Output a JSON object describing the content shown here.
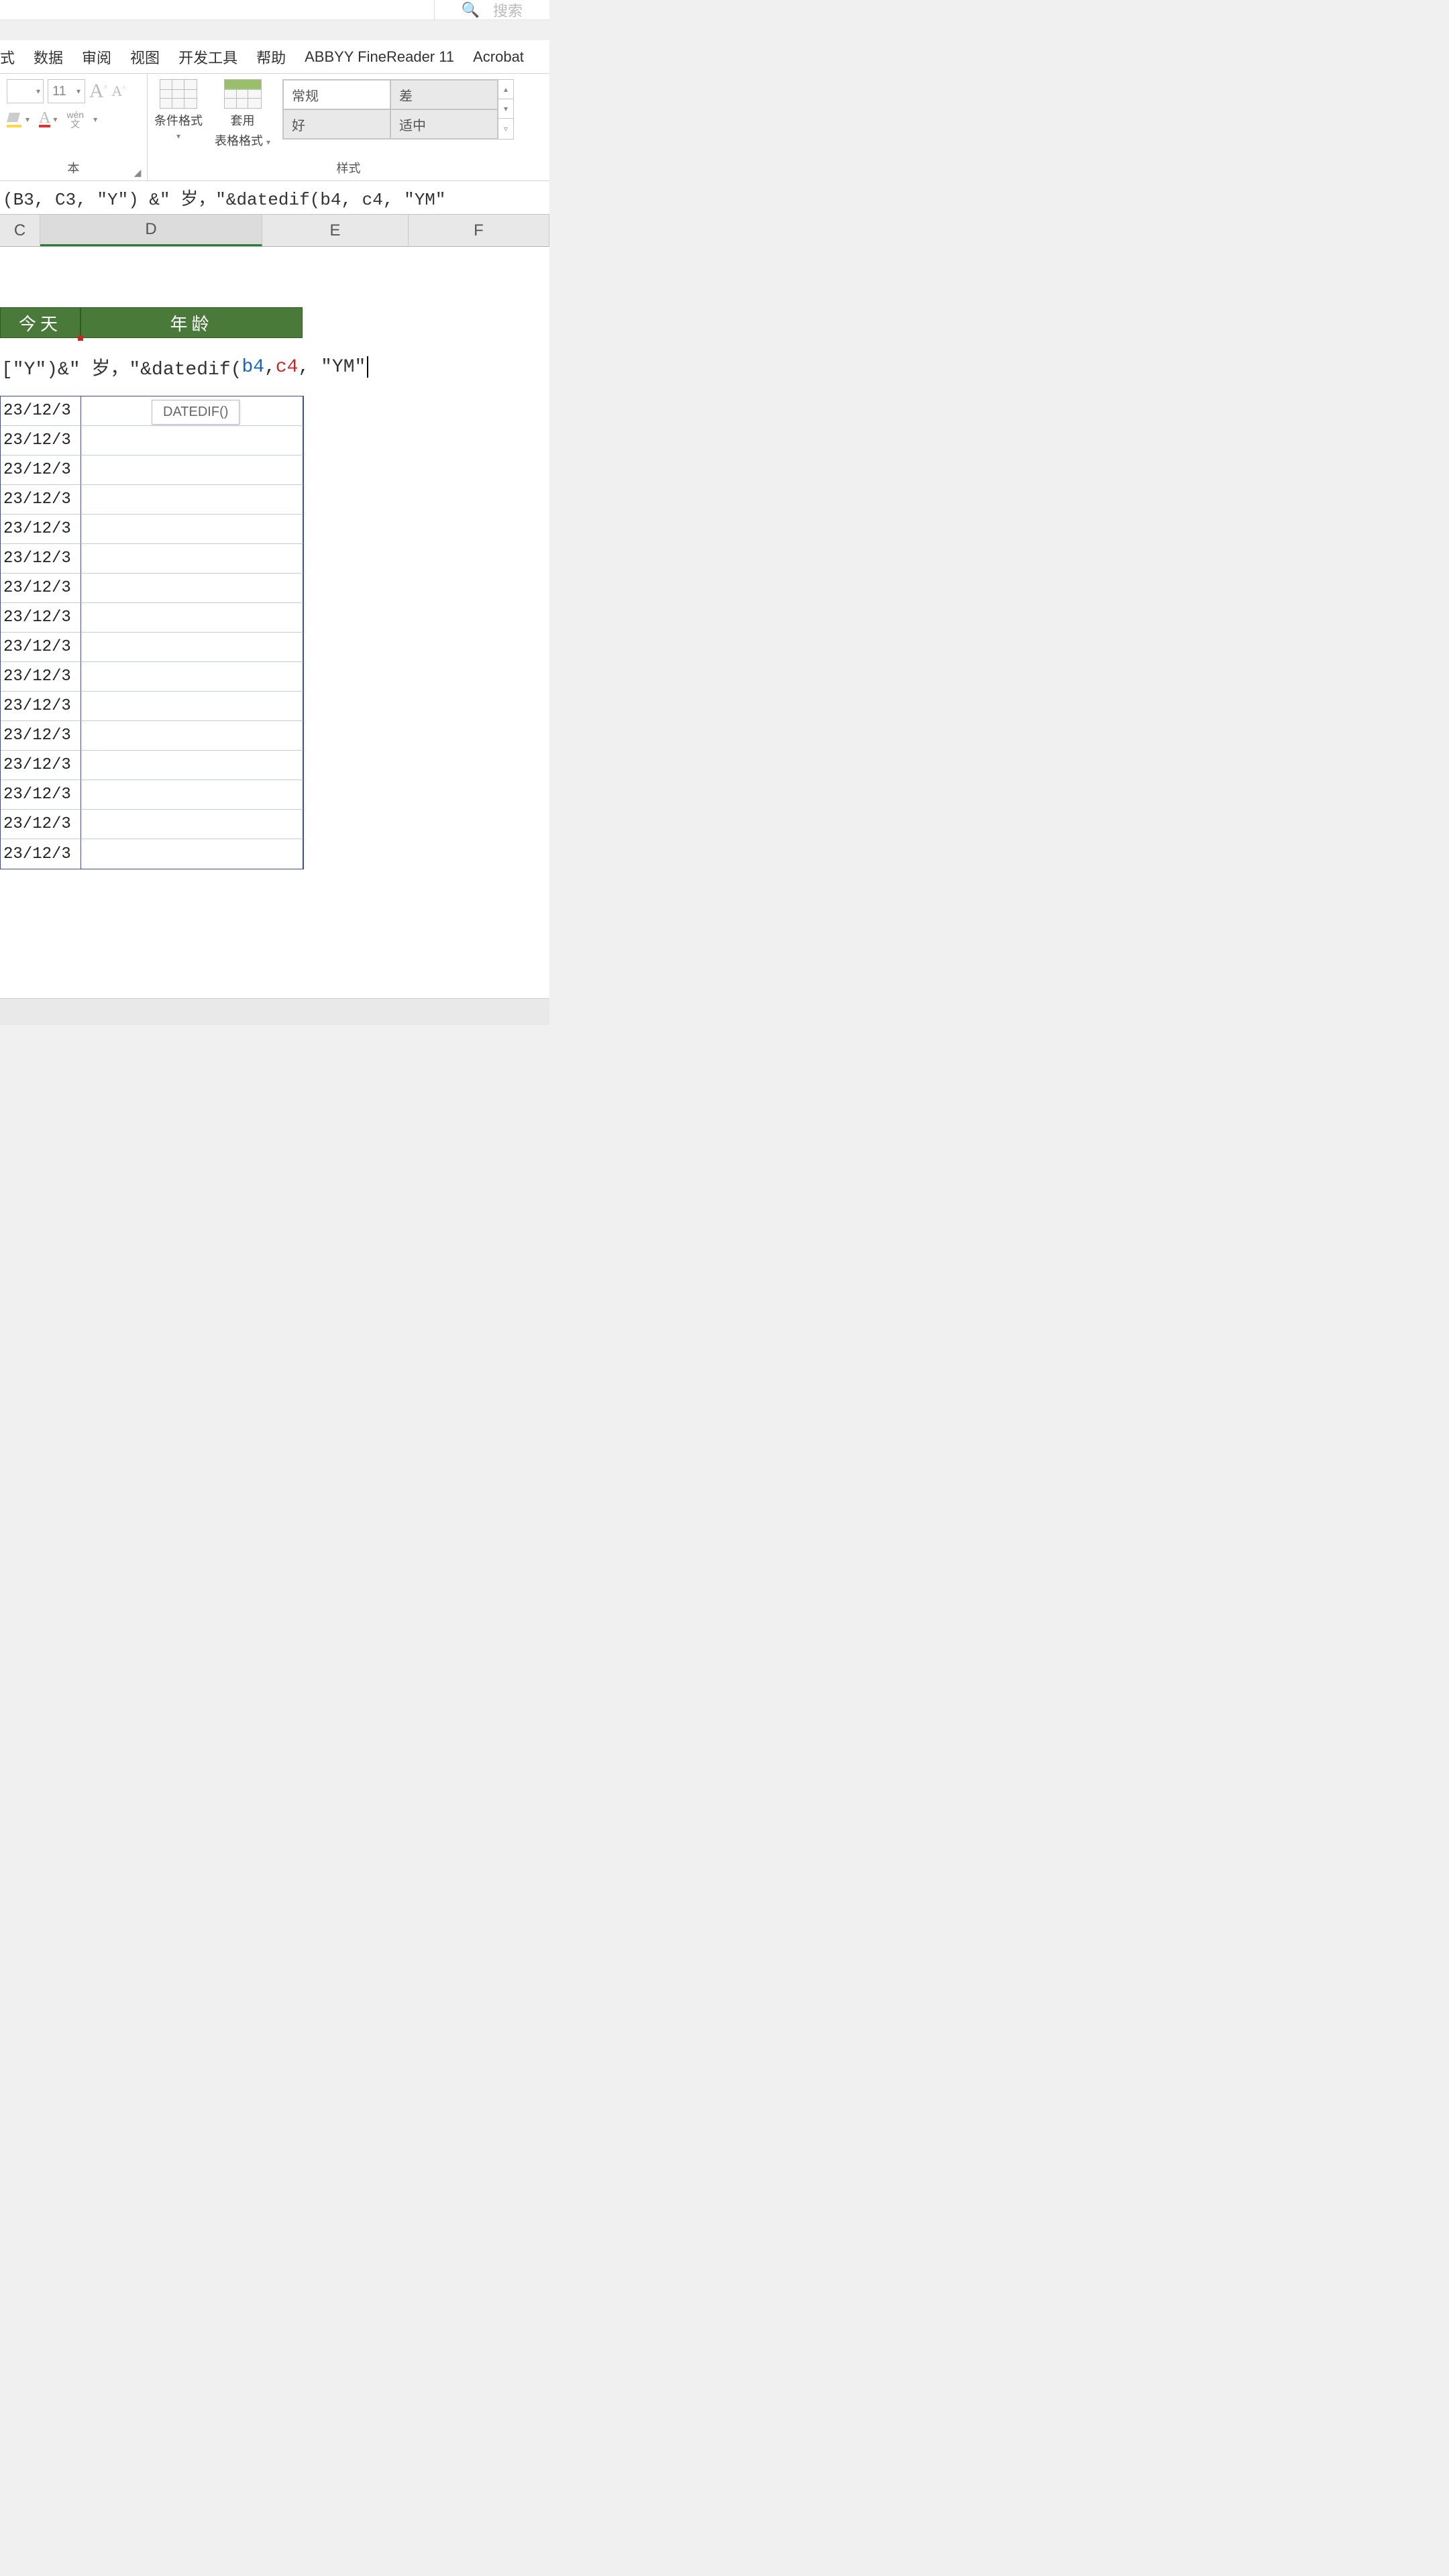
{
  "titlebar": {
    "search_placeholder": "搜索"
  },
  "menu": {
    "items": [
      "式",
      "数据",
      "审阅",
      "视图",
      "开发工具",
      "帮助",
      "ABBYY FineReader 11",
      "Acrobat"
    ]
  },
  "ribbon": {
    "font_size": "11",
    "cond_fmt": "条件格式",
    "tbl_fmt_l1": "套用",
    "tbl_fmt_l2": "表格格式",
    "gallery": {
      "normal": "常规",
      "bad": "差",
      "good": "好",
      "neutral": "适中"
    },
    "styles_label": "样式",
    "wen": "wén",
    "wen2": "文"
  },
  "formula_bar": {
    "text": "(B3, C3, \"Y\") &\" 岁，\"&datedif(b4, c4, \"YM\""
  },
  "columns": {
    "c": "C",
    "d": "D",
    "e": "E",
    "f": "F"
  },
  "headers": {
    "today": "今天",
    "age": "年龄"
  },
  "edit_cell": {
    "p1": "[\"Y\")&\" 岁，\"&datedif(",
    "ref_b": "b4",
    "comma": ", ",
    "ref_c": "c4",
    "p2": ", \"YM\""
  },
  "tooltip": "DATEDIF()",
  "rows": [
    "23/12/3",
    "23/12/3",
    "23/12/3",
    "23/12/3",
    "23/12/3",
    "23/12/3",
    "23/12/3",
    "23/12/3",
    "23/12/3",
    "23/12/3",
    "23/12/3",
    "23/12/3",
    "23/12/3",
    "23/12/3",
    "23/12/3",
    "23/12/3"
  ]
}
